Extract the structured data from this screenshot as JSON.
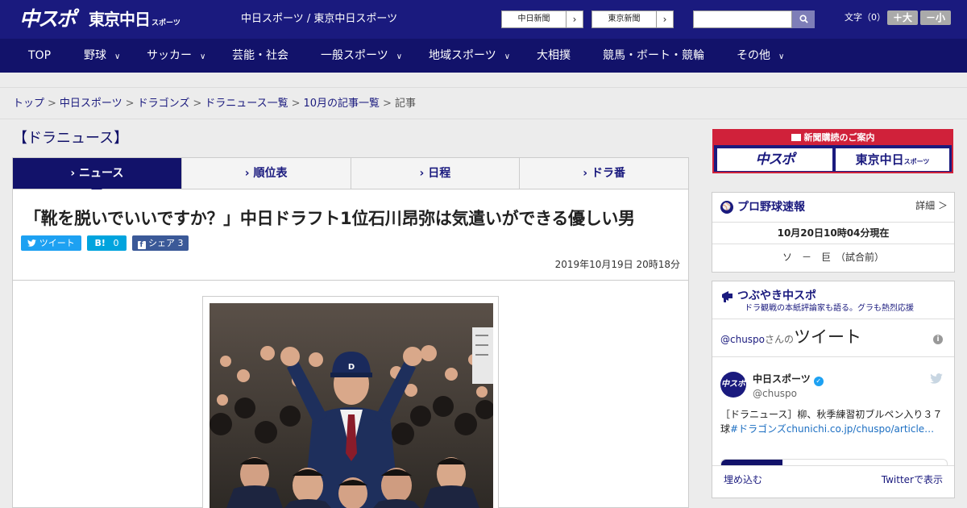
{
  "header": {
    "logo_chuspo": "中スポ",
    "logo_tokyo": "東京中日",
    "logo_tokyo_sub": "スポーツ",
    "site_names": "中日スポーツ / 東京中日スポーツ",
    "papers": [
      {
        "label": "中日新聞",
        "arrow": "›"
      },
      {
        "label": "東京新聞",
        "arrow": "›"
      }
    ],
    "search_placeholder": "",
    "search_icon": "magnifier-icon",
    "font_size_label": "文字（0）",
    "font_larger": "＋大",
    "font_smaller": "－小"
  },
  "nav": {
    "items": [
      {
        "label": "TOP",
        "chevron": ""
      },
      {
        "label": "野球",
        "chevron": "∨"
      },
      {
        "label": "サッカー",
        "chevron": "∨"
      },
      {
        "label": "芸能・社会",
        "chevron": ""
      },
      {
        "label": "一般スポーツ",
        "chevron": "∨"
      },
      {
        "label": "地域スポーツ",
        "chevron": "∨"
      },
      {
        "label": "大相撲",
        "chevron": ""
      },
      {
        "label": "競馬・ボート・競輪",
        "chevron": ""
      },
      {
        "label": "その他",
        "chevron": "∨"
      }
    ]
  },
  "breadcrumb": {
    "links": [
      "トップ",
      "中日スポーツ",
      "ドラゴンズ",
      "ドラニュース一覧",
      "10月の記事一覧"
    ],
    "separator": ">",
    "current": "記事"
  },
  "main": {
    "section_title": "【ドラニュース】",
    "tabs": [
      {
        "label": "ニュース",
        "active": true
      },
      {
        "label": "順位表",
        "active": false
      },
      {
        "label": "日程",
        "active": false
      },
      {
        "label": "ドラ番",
        "active": false
      }
    ],
    "headline": "「靴を脱いでいいですか？」中日ドラフト1位石川昂弥は気遣いができる優しい男",
    "share": {
      "tweet": "ツイート",
      "hatena_mark": "B!",
      "hatena_count": "0",
      "facebook": "シェア",
      "facebook_count": "3"
    },
    "date": "2019年10月19日 20時18分"
  },
  "sidebar": {
    "subscribe": {
      "title": "新聞購読のご案内",
      "logo1": "中スポ",
      "logo2": "東京中日",
      "logo2_sub": "スポーツ"
    },
    "baseball": {
      "title": "プロ野球速報",
      "detail": "詳細 ＞",
      "time": "10月20日10時04分現在",
      "game": "ソ　－　巨　（試合前）"
    },
    "twitter": {
      "title": "つぶやき中スポ",
      "subtitle": "ドラ観戦の本紙評論家も語る。グラも熱烈応援",
      "handle_prefix": "@chuspo",
      "handle_suffix": "さんの",
      "tweets_label": "ツイート",
      "avatar_text": "中スポ",
      "account_name": "中日スポーツ",
      "account_handle": "@chuspo",
      "tweet_text": "［ドラニュース］柳、秋季練習初ブルペン入り３７球",
      "tweet_link": "#ドラゴンズchunichi.co.jp/chuspo/article…",
      "embed": "埋め込む",
      "view_on_twitter": "Twitterで表示"
    }
  },
  "colors": {
    "brand_navy": "#1a1a7e",
    "nav_navy": "#12126a",
    "twitter_blue": "#1da1f2",
    "hatena_blue": "#00a4de",
    "facebook_blue": "#3b5998",
    "subscribe_red": "#d0213a"
  }
}
